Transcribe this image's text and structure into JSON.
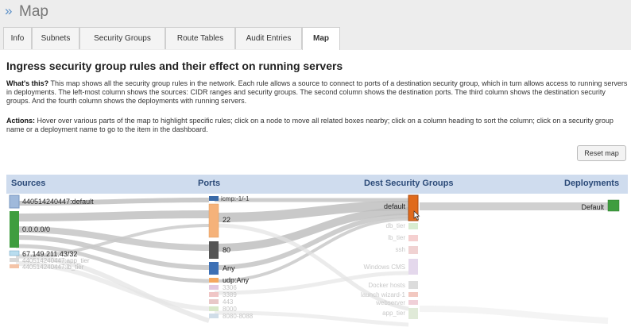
{
  "header": {
    "chevron": "»",
    "title": "Map"
  },
  "tabs": [
    {
      "label": "Info",
      "active": false
    },
    {
      "label": "Subnets",
      "active": false
    },
    {
      "label": "Security Groups",
      "active": false
    },
    {
      "label": "Route Tables",
      "active": false
    },
    {
      "label": "Audit Entries",
      "active": false
    },
    {
      "label": "Map",
      "active": true
    }
  ],
  "page": {
    "heading": "Ingress security group rules and their effect on running servers",
    "whats_this_label": "What's this?",
    "whats_this_text": "This map shows all the security group rules in the network. Each rule allows a source to connect to ports of a destination security group, which in turn allows access to running servers in deployments. The left-most column shows the sources: CIDR ranges and security groups. The second column shows the destination ports. The third column shows the destination security groups. And the fourth column shows the deployments with running servers.",
    "actions_label": "Actions:",
    "actions_text": "Hover over various parts of the map to highlight specific rules; click on a node to move all related boxes nearby; click on a column heading to sort the column; click on a security group name or a deployment name to go to the item in the dashboard.",
    "reset_label": "Reset map"
  },
  "map": {
    "columns": [
      "Sources",
      "Ports",
      "Dest Security Groups",
      "Deployments"
    ],
    "sources": [
      {
        "label": "440514240447:default",
        "color": "#9fb9db"
      },
      {
        "label": "0.0.0.0/0",
        "color": "#3f9d3f"
      },
      {
        "label": "67.149.211.43/32",
        "color": "#b9ddef"
      },
      {
        "label": "440514240447:app_tier",
        "color": "#d8d8d8"
      },
      {
        "label": "440514240447:lb_tier",
        "color": "#f4c4a8"
      }
    ],
    "ports": [
      {
        "label": "icmp:-1/-1",
        "color": "#3a6aa8"
      },
      {
        "label": "22",
        "color": "#f5b27a"
      },
      {
        "label": "80",
        "color": "#555555"
      },
      {
        "label": "Any",
        "color": "#3d70b5"
      },
      {
        "label": "udp:Any",
        "color": "#f4a860"
      },
      {
        "label": "3306",
        "color": "#e3c8df"
      },
      {
        "label": "3389",
        "color": "#f0c6c6"
      },
      {
        "label": "443",
        "color": "#e8c8c8"
      },
      {
        "label": "8000",
        "color": "#d8e8c8"
      },
      {
        "label": "8080-8088",
        "color": "#d0dde8"
      }
    ],
    "dest_groups": [
      {
        "label": "default",
        "color": "#e06a1c"
      },
      {
        "label": "db_tier",
        "color": "#d8ecd0"
      },
      {
        "label": "lb_tier",
        "color": "#f5d0d0"
      },
      {
        "label": "ssh",
        "color": "#f0d2d2"
      },
      {
        "label": "Windows CMS",
        "color": "#e4d8ec"
      },
      {
        "label": "Docker hosts",
        "color": "#dcdcdc"
      },
      {
        "label": "launch wizard-1",
        "color": "#f2c8c0"
      },
      {
        "label": "webserver",
        "color": "#f0d0d8"
      },
      {
        "label": "app_tier",
        "color": "#e0ead8"
      }
    ],
    "deployments": [
      {
        "label": "Default",
        "color": "#3f9d3f"
      }
    ]
  }
}
